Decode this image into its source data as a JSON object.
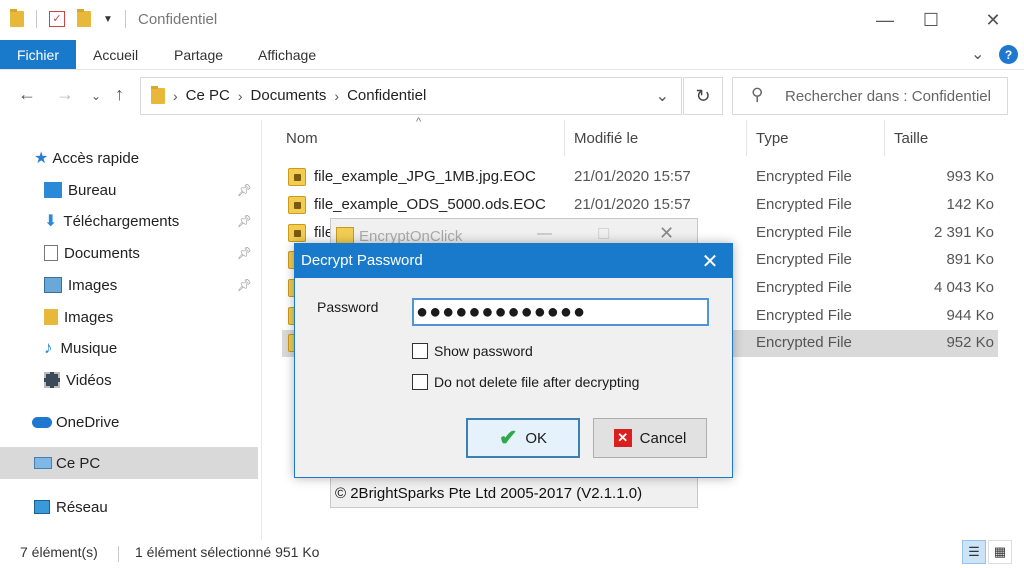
{
  "window": {
    "title": "Confidentiel"
  },
  "ribbon": {
    "tabs": [
      "Fichier",
      "Accueil",
      "Partage",
      "Affichage"
    ],
    "help": "?"
  },
  "address": {
    "crumbs": [
      "Ce PC",
      "Documents",
      "Confidentiel"
    ]
  },
  "search": {
    "placeholder": "Rechercher dans : Confidentiel"
  },
  "nav": {
    "items": [
      {
        "label": "Accès rapide",
        "icon": "star-icon"
      },
      {
        "label": "Bureau",
        "icon": "desktop-icon"
      },
      {
        "label": "Téléchargements",
        "icon": "download-icon"
      },
      {
        "label": "Documents",
        "icon": "document-icon"
      },
      {
        "label": "Images",
        "icon": "image-icon"
      },
      {
        "label": "Images",
        "icon": "folder-icon"
      },
      {
        "label": "Musique",
        "icon": "music-icon"
      },
      {
        "label": "Vidéos",
        "icon": "video-icon"
      },
      {
        "label": "OneDrive",
        "icon": "cloud-icon"
      },
      {
        "label": "Ce PC",
        "icon": "computer-icon"
      },
      {
        "label": "Réseau",
        "icon": "network-icon"
      }
    ]
  },
  "columns": {
    "name": "Nom",
    "modified": "Modifié le",
    "type": "Type",
    "size": "Taille"
  },
  "files": [
    {
      "name": "file_example_JPG_1MB.jpg.EOC",
      "date": "21/01/2020 15:57",
      "type": "Encrypted File",
      "size": "993 Ko"
    },
    {
      "name": "file_example_ODS_5000.ods.EOC",
      "date": "21/01/2020 15:57",
      "type": "Encrypted File",
      "size": "142 Ko"
    },
    {
      "name": "file",
      "date": "",
      "type": "Encrypted File",
      "size": "2 391 Ko"
    },
    {
      "name": "",
      "date": "",
      "type": "Encrypted File",
      "size": "891 Ko"
    },
    {
      "name": "",
      "date": "",
      "type": "Encrypted File",
      "size": "4 043 Ko"
    },
    {
      "name": "",
      "date": "",
      "type": "Encrypted File",
      "size": "944 Ko"
    },
    {
      "name": "",
      "date": "",
      "type": "Encrypted File",
      "size": "952 Ko"
    }
  ],
  "status": {
    "count": "7 élément(s)",
    "selection": "1 élément sélectionné  951 Ko"
  },
  "bg_window": {
    "title": "EncryptOnClick",
    "copyright": "© 2BrightSparks Pte Ltd 2005-2017 (V2.1.1.0)"
  },
  "dialog": {
    "title": "Decrypt Password",
    "password_label": "Password",
    "password_value": "●●●●●●●●●●●●●",
    "show_password": "Show password",
    "no_delete": "Do not delete file after decrypting",
    "ok": "OK",
    "cancel": "Cancel"
  }
}
